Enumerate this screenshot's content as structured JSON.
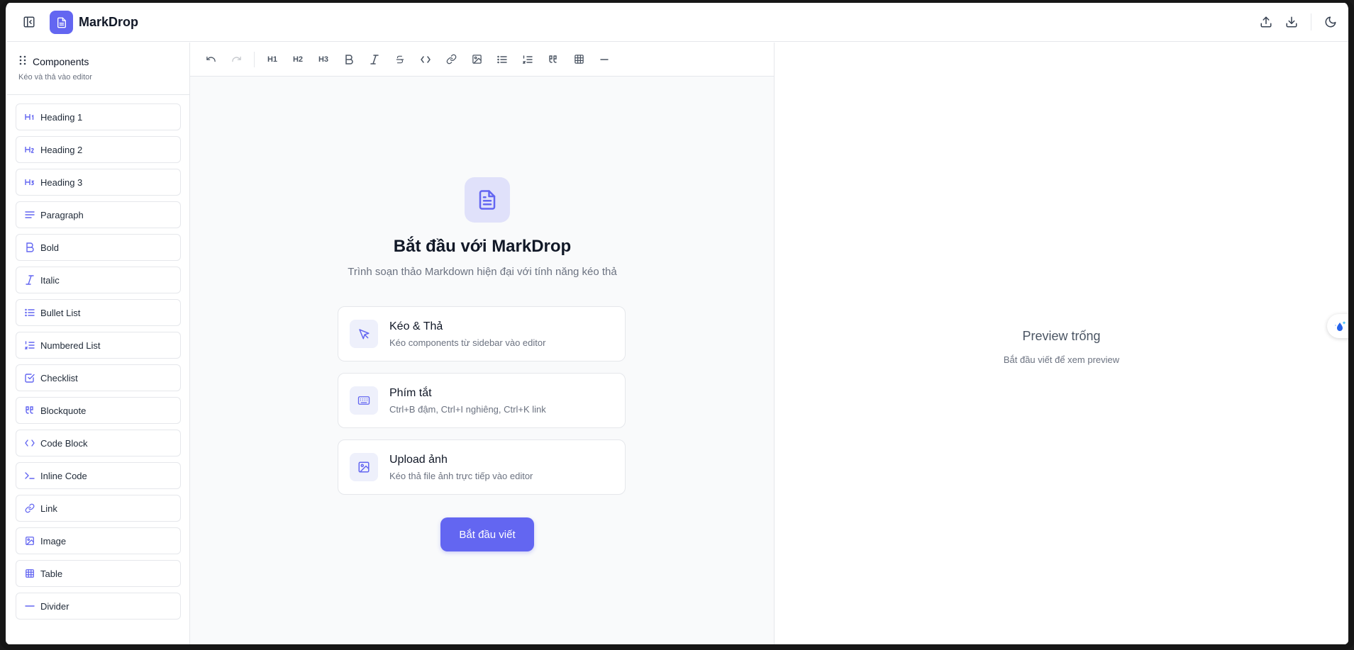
{
  "header": {
    "app_title": "MarkDrop",
    "icons": [
      "sidebar-toggle-icon",
      "document-icon",
      "upload-icon",
      "download-icon",
      "moon-icon"
    ]
  },
  "sidebar": {
    "title": "Components",
    "subtitle": "Kéo và thả vào editor",
    "items": [
      {
        "label": "Heading 1",
        "icon": "H1"
      },
      {
        "label": "Heading 2",
        "icon": "H2"
      },
      {
        "label": "Heading 3",
        "icon": "H3"
      },
      {
        "label": "Paragraph",
        "icon": "paragraph-icon"
      },
      {
        "label": "Bold",
        "icon": "bold-icon"
      },
      {
        "label": "Italic",
        "icon": "italic-icon"
      },
      {
        "label": "Bullet List",
        "icon": "bullet-list-icon"
      },
      {
        "label": "Numbered List",
        "icon": "numbered-list-icon"
      },
      {
        "label": "Checklist",
        "icon": "checklist-icon"
      },
      {
        "label": "Blockquote",
        "icon": "quote-icon"
      },
      {
        "label": "Code Block",
        "icon": "code-icon"
      },
      {
        "label": "Inline Code",
        "icon": "terminal-icon"
      },
      {
        "label": "Link",
        "icon": "link-icon"
      },
      {
        "label": "Image",
        "icon": "image-icon"
      },
      {
        "label": "Table",
        "icon": "table-icon"
      },
      {
        "label": "Divider",
        "icon": "divider-icon"
      }
    ]
  },
  "toolbar": {
    "h1": "H1",
    "h2": "H2",
    "h3": "H3"
  },
  "welcome": {
    "title": "Bắt đầu với MarkDrop",
    "subtitle": "Trình soạn thảo Markdown hiện đại với tính năng kéo thả",
    "cards": [
      {
        "title": "Kéo & Thả",
        "desc": "Kéo components từ sidebar vào editor",
        "icon": "cursor-icon"
      },
      {
        "title": "Phím tắt",
        "desc": "Ctrl+B đậm, Ctrl+I nghiêng, Ctrl+K link",
        "icon": "keyboard-icon"
      },
      {
        "title": "Upload ảnh",
        "desc": "Kéo thả file ảnh trực tiếp vào editor",
        "icon": "image-icon"
      }
    ],
    "start_button": "Bắt đầu viết"
  },
  "preview": {
    "title": "Preview trống",
    "subtitle": "Bắt đầu viết để xem preview"
  },
  "colors": {
    "accent": "#6366f1",
    "accent_light": "#e0e1fa",
    "border": "#e5e7eb",
    "muted_text": "#6b7280"
  }
}
